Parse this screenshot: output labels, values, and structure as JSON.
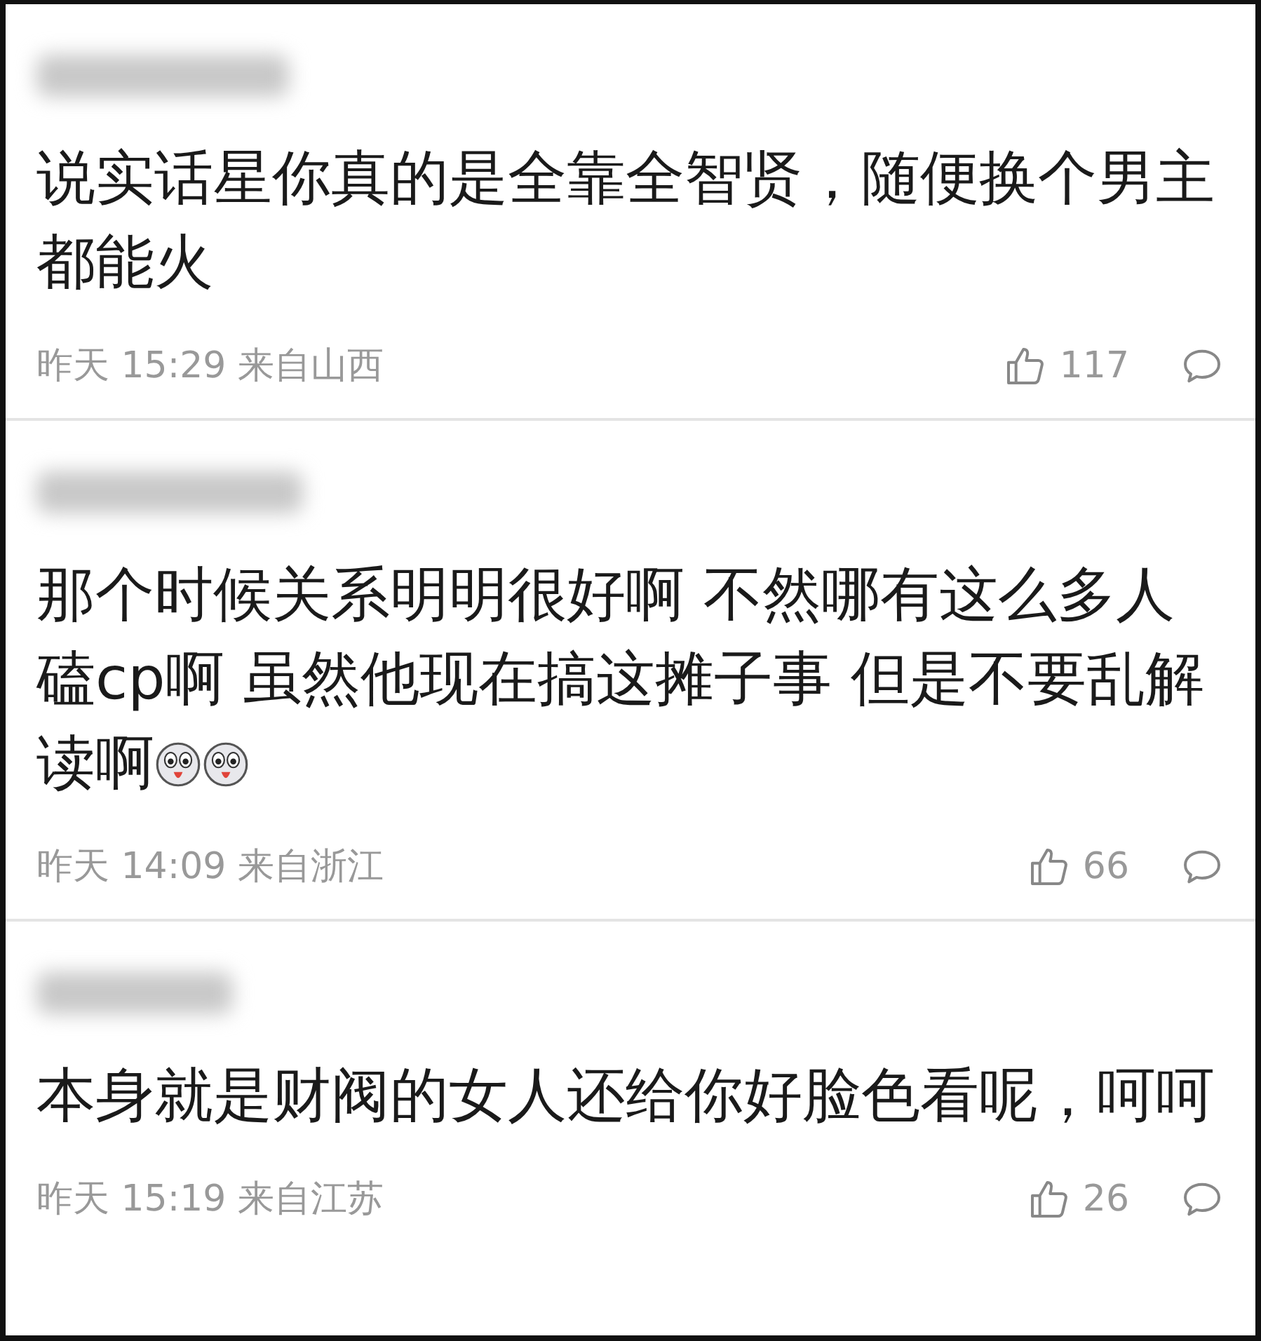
{
  "comments": [
    {
      "text": "说实话星你真的是全靠全智贤，随便换个男主都能火",
      "time": "昨天 15:29 来自山西",
      "likes": "117"
    },
    {
      "text": "那个时候关系明明很好啊 不然哪有这么多人磕cp啊 虽然他现在搞这摊子事 但是不要乱解读啊",
      "trailing_icons": [
        {
          "kind": "dog"
        },
        {
          "kind": "dog"
        }
      ],
      "time": "昨天 14:09 来自浙江",
      "likes": "66"
    },
    {
      "text": "本身就是财阀的女人还给你好脸色看呢，呵呵",
      "time": "昨天 15:19 来自江苏",
      "likes": "26"
    }
  ]
}
